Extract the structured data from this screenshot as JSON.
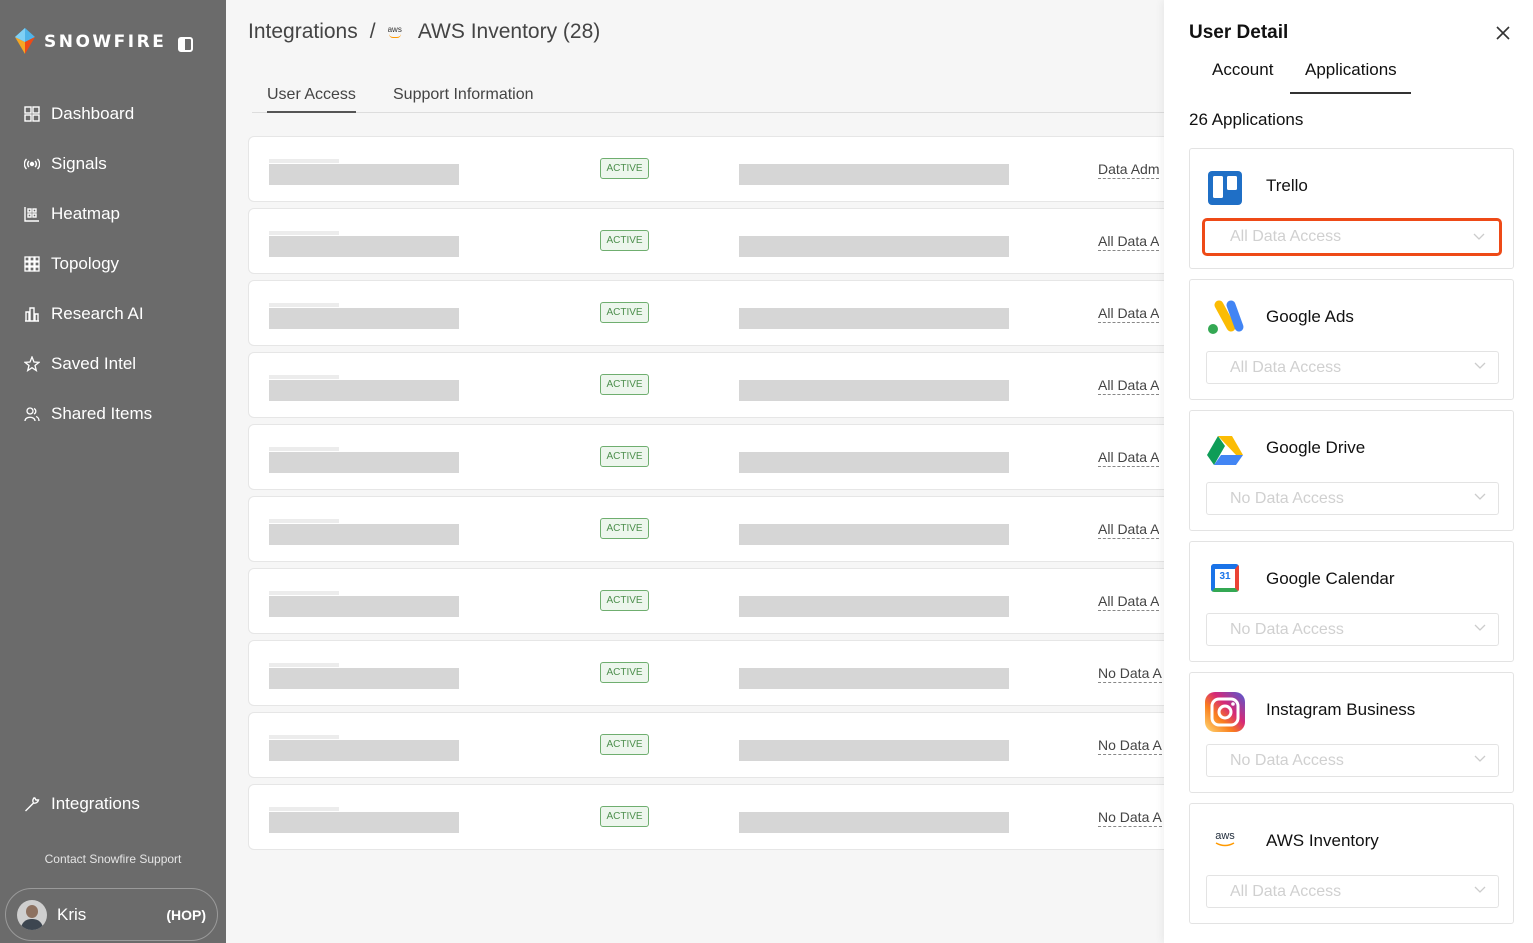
{
  "brand": {
    "name": "SNOWFIRE"
  },
  "sidebar": {
    "items": [
      {
        "label": "Dashboard",
        "icon": "dashboard-icon"
      },
      {
        "label": "Signals",
        "icon": "signal-icon"
      },
      {
        "label": "Heatmap",
        "icon": "heatmap-icon"
      },
      {
        "label": "Topology",
        "icon": "topology-icon"
      },
      {
        "label": "Research AI",
        "icon": "research-icon"
      },
      {
        "label": "Saved Intel",
        "icon": "star-icon"
      },
      {
        "label": "Shared Items",
        "icon": "users-icon"
      }
    ],
    "integrations": {
      "label": "Integrations",
      "icon": "wrench-icon"
    },
    "support": "Contact Snowfire Support",
    "user": {
      "name": "Kris",
      "role": "(HOP)"
    }
  },
  "header": {
    "breadcrumb_root": "Integrations",
    "separator": "/",
    "aws_logo_text": "aws",
    "breadcrumb_current": "AWS Inventory (28)"
  },
  "tabs": [
    "User Access",
    "Support Information"
  ],
  "rows": [
    {
      "status": "ACTIVE",
      "access": "Data Adm"
    },
    {
      "status": "ACTIVE",
      "access": "All Data A"
    },
    {
      "status": "ACTIVE",
      "access": "All Data A"
    },
    {
      "status": "ACTIVE",
      "access": "All Data A"
    },
    {
      "status": "ACTIVE",
      "access": "All Data A"
    },
    {
      "status": "ACTIVE",
      "access": "All Data A"
    },
    {
      "status": "ACTIVE",
      "access": "All Data A"
    },
    {
      "status": "ACTIVE",
      "access": "No Data A"
    },
    {
      "status": "ACTIVE",
      "access": "No Data A"
    },
    {
      "status": "ACTIVE",
      "access": "No Data A"
    }
  ],
  "panel": {
    "title": "User Detail",
    "tabs": [
      "Account",
      "Applications"
    ],
    "active_tab": "Applications",
    "count_label": "26 Applications",
    "apps": [
      {
        "name": "Trello",
        "access": "All Data Access",
        "icon": "trello-icon",
        "highlighted": true
      },
      {
        "name": "Google Ads",
        "access": "All Data Access",
        "icon": "google-ads-icon"
      },
      {
        "name": "Google Drive",
        "access": "No Data Access",
        "icon": "google-drive-icon"
      },
      {
        "name": "Google Calendar",
        "access": "No Data Access",
        "icon": "google-calendar-icon",
        "calendar_day": "31"
      },
      {
        "name": "Instagram Business",
        "access": "No Data Access",
        "icon": "instagram-icon"
      },
      {
        "name": "AWS Inventory",
        "access": "All Data Access",
        "icon": "aws-icon",
        "logo_text": "aws"
      }
    ]
  },
  "colors": {
    "sidebar": "#6b6b6b",
    "active_badge": "#4d8f4d",
    "highlight": "#ee4a17"
  }
}
